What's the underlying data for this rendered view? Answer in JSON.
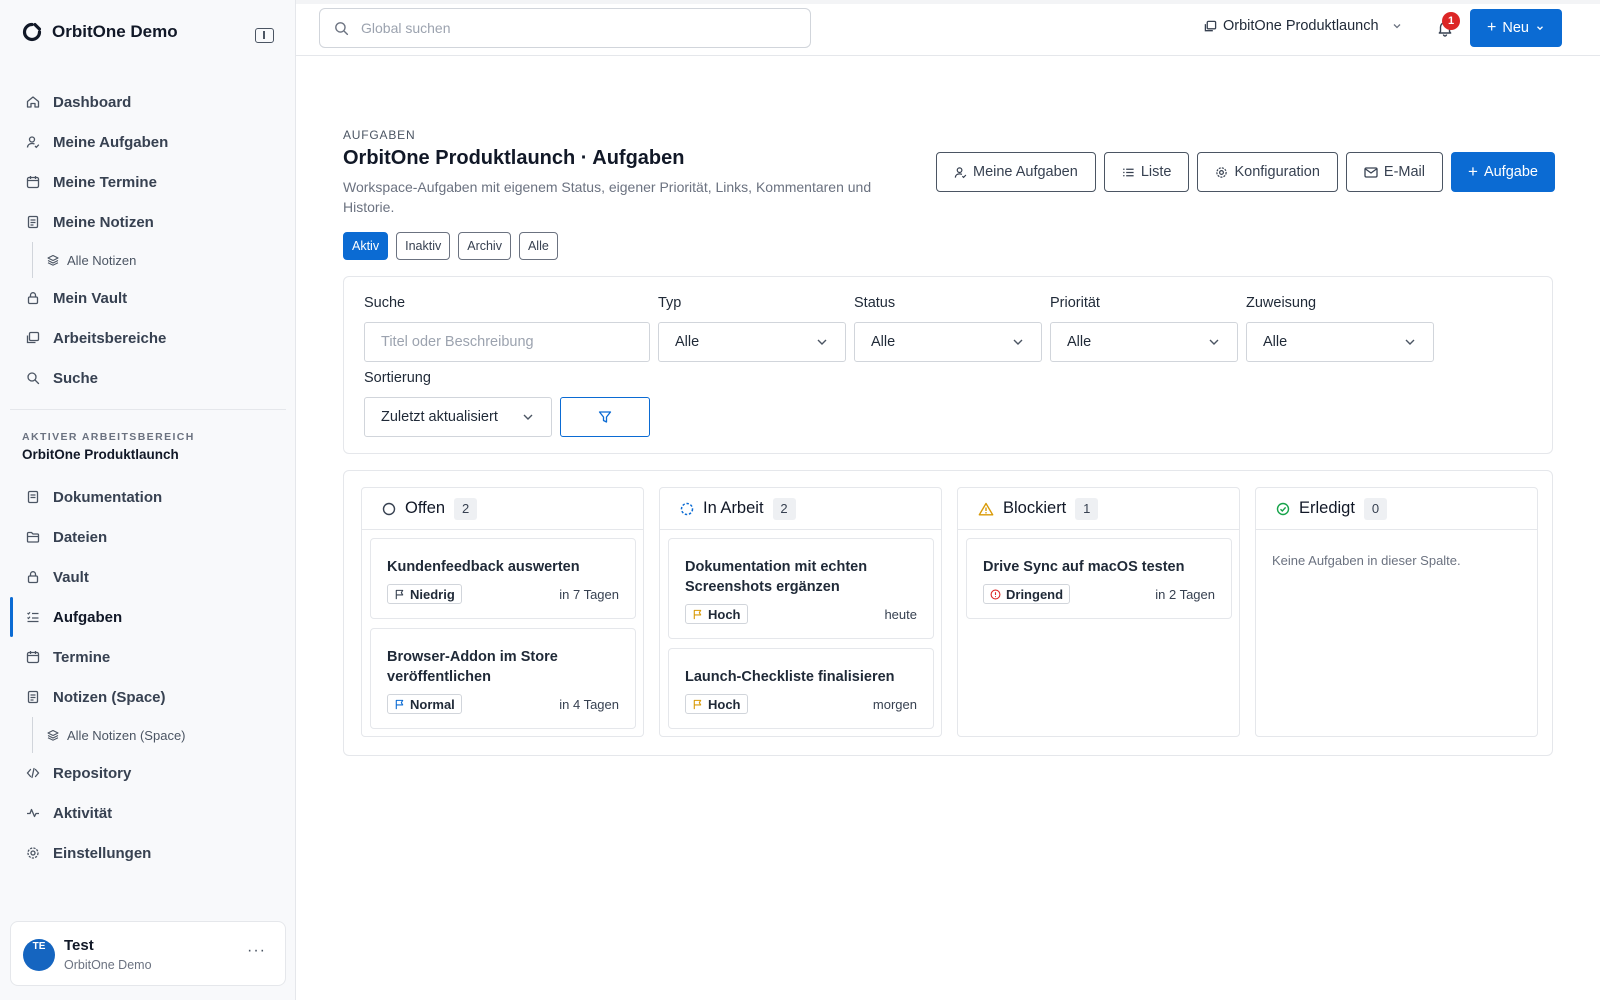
{
  "app": {
    "title": "OrbitOne Demo"
  },
  "sidebar": {
    "nav": [
      {
        "label": "Dashboard"
      },
      {
        "label": "Meine Aufgaben"
      },
      {
        "label": "Meine Termine"
      },
      {
        "label": "Meine Notizen"
      },
      {
        "label": "Alle Notizen"
      },
      {
        "label": "Mein Vault"
      },
      {
        "label": "Arbeitsbereiche"
      },
      {
        "label": "Suche"
      }
    ],
    "workspace_label": "AKTIVER ARBEITSBEREICH",
    "workspace_name": "OrbitOne Produktlaunch",
    "workspace_nav": [
      {
        "label": "Dokumentation"
      },
      {
        "label": "Dateien"
      },
      {
        "label": "Vault"
      },
      {
        "label": "Aufgaben",
        "active": true
      },
      {
        "label": "Termine"
      },
      {
        "label": "Notizen (Space)"
      },
      {
        "label": "Alle Notizen (Space)"
      },
      {
        "label": "Repository"
      },
      {
        "label": "Aktivität"
      },
      {
        "label": "Einstellungen"
      }
    ],
    "user": {
      "initials": "TE",
      "name": "Test",
      "org": "OrbitOne Demo",
      "more": "···"
    }
  },
  "topbar": {
    "search_placeholder": "Global suchen",
    "workspace": "OrbitOne Produktlaunch",
    "notifications": "1",
    "new_label": "Neu"
  },
  "header": {
    "eyebrow": "AUFGABEN",
    "title": "OrbitOne Produktlaunch · Aufgaben",
    "description": "Workspace-Aufgaben mit eigenem Status, eigener Priorität, Links, Kommentaren und Historie.",
    "buttons": {
      "my_tasks": "Meine Aufgaben",
      "list": "Liste",
      "config": "Konfiguration",
      "email": "E-Mail",
      "add_task": "Aufgabe"
    }
  },
  "status_tabs": [
    {
      "label": "Aktiv",
      "active": true
    },
    {
      "label": "Inaktiv"
    },
    {
      "label": "Archiv"
    },
    {
      "label": "Alle"
    }
  ],
  "filters": {
    "search_label": "Suche",
    "search_placeholder": "Titel oder Beschreibung",
    "type_label": "Typ",
    "type_value": "Alle",
    "status_label": "Status",
    "status_value": "Alle",
    "priority_label": "Priorität",
    "priority_value": "Alle",
    "assignment_label": "Zuweisung",
    "assignment_value": "Alle",
    "sort_label": "Sortierung",
    "sort_value": "Zuletzt aktualisiert"
  },
  "board": {
    "columns": [
      {
        "title": "Offen",
        "count": "2",
        "tasks": [
          {
            "title": "Kundenfeedback auswerten",
            "priority": "Niedrig",
            "due": "in 7 Tagen"
          },
          {
            "title": "Browser-Addon im Store veröffentlichen",
            "priority": "Normal",
            "due": "in 4 Tagen"
          }
        ]
      },
      {
        "title": "In Arbeit",
        "count": "2",
        "tasks": [
          {
            "title": "Dokumentation mit echten Screenshots ergänzen",
            "priority": "Hoch",
            "due": "heute"
          },
          {
            "title": "Launch-Checkliste finalisieren",
            "priority": "Hoch",
            "due": "morgen"
          }
        ]
      },
      {
        "title": "Blockiert",
        "count": "1",
        "tasks": [
          {
            "title": "Drive Sync auf macOS testen",
            "priority": "Dringend",
            "due": "in 2 Tagen"
          }
        ]
      },
      {
        "title": "Erledigt",
        "count": "0",
        "empty": "Keine Aufgaben in dieser Spalte."
      }
    ]
  },
  "colors": {
    "accent": "#0b6bd3",
    "danger": "#dc2626",
    "warning": "#d99a06",
    "success": "#16a34a"
  }
}
